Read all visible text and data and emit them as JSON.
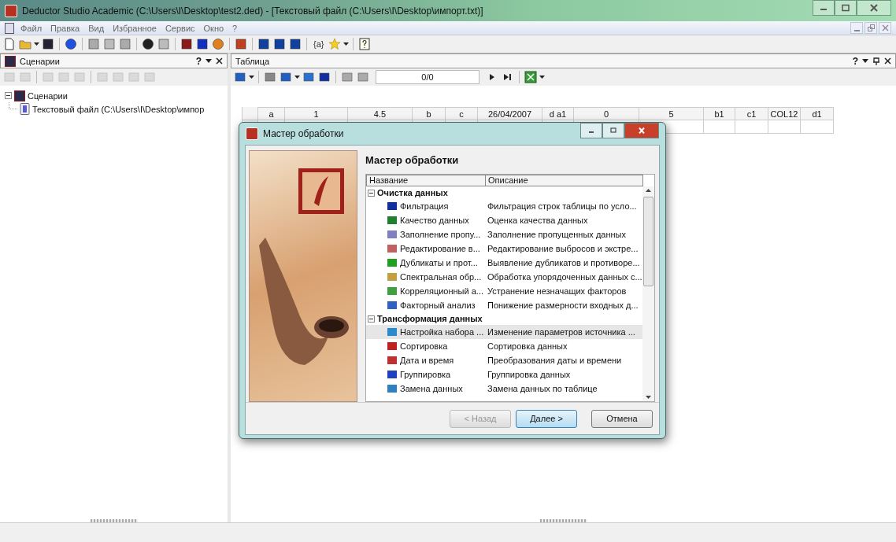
{
  "window": {
    "title": "Deductor Studio Academic (C:\\Users\\I\\Desktop\\test2.ded) - [Текстовый файл (C:\\Users\\I\\Desktop\\импорт.txt)]"
  },
  "menu": [
    "Файл",
    "Правка",
    "Вид",
    "Избранное",
    "Сервис",
    "Окно",
    "?"
  ],
  "toolbar": {
    "variable_label": "{a}"
  },
  "left_pane": {
    "title": "Сценарии",
    "help": "?",
    "tree": [
      {
        "label": "Сценарии",
        "expanded": true,
        "children": [
          {
            "label": "Текстовый файл (C:\\Users\\I\\Desktop\\импор"
          }
        ]
      }
    ]
  },
  "right_pane": {
    "title": "Таблица",
    "help": "?",
    "record_counter": "0/0",
    "table": {
      "columns": [
        "a",
        "1",
        "4.5",
        "b",
        "c",
        "26/04/2007",
        "d a1",
        "0",
        "5",
        "b1",
        "c1",
        "COL12",
        "d1"
      ]
    }
  },
  "dialog": {
    "title": "Мастер обработки",
    "heading": "Мастер обработки",
    "list": {
      "columns": [
        "Название",
        "Описание"
      ],
      "groups": [
        {
          "label": "Очистка данных",
          "expanded": true,
          "items": [
            {
              "name": "Фильтрация",
              "description": "Фильтрация строк таблицы по усло...",
              "selected": false
            },
            {
              "name": "Качество данных",
              "description": "Оценка качества данных",
              "selected": false
            },
            {
              "name": "Заполнение пропу...",
              "description": "Заполнение пропущенных данных",
              "selected": false
            },
            {
              "name": "Редактирование в...",
              "description": "Редактирование выбросов и экстре...",
              "selected": false
            },
            {
              "name": "Дубликаты и прот...",
              "description": "Выявление дубликатов и противоре...",
              "selected": false
            },
            {
              "name": "Спектральная обр...",
              "description": "Обработка упорядоченных данных с...",
              "selected": false
            },
            {
              "name": "Корреляционный а...",
              "description": "Устранение незначащих факторов",
              "selected": false
            },
            {
              "name": "Факторный анализ",
              "description": "Понижение размерности входных д...",
              "selected": false
            }
          ]
        },
        {
          "label": "Трансформация данных",
          "expanded": true,
          "items": [
            {
              "name": "Настройка набора ...",
              "description": "Изменение параметров источника ...",
              "selected": true
            },
            {
              "name": "Сортировка",
              "description": "Сортировка данных",
              "selected": false
            },
            {
              "name": "Дата и время",
              "description": "Преобразования даты и времени",
              "selected": false
            },
            {
              "name": "Группировка",
              "description": "Группировка данных",
              "selected": false
            },
            {
              "name": "Замена данных",
              "description": "Замена данных по таблице",
              "selected": false
            }
          ]
        }
      ]
    },
    "buttons": [
      {
        "label": "< Назад",
        "disabled": true,
        "default": false
      },
      {
        "label": "Далее >",
        "disabled": false,
        "default": true
      },
      {
        "label": "Отмена",
        "disabled": false,
        "default": false
      }
    ]
  }
}
